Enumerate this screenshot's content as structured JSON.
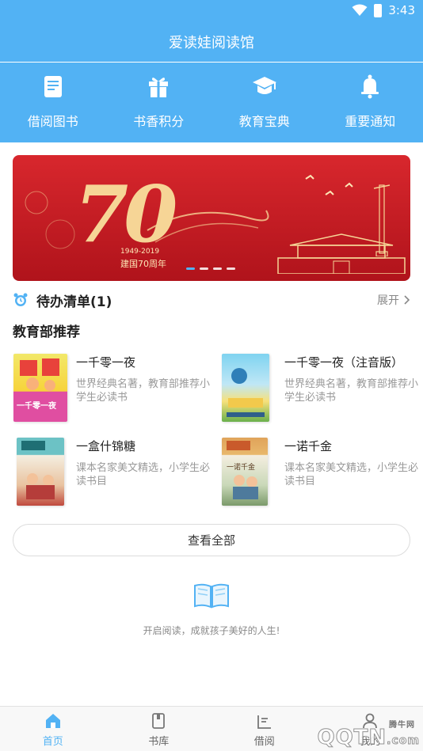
{
  "status_bar": {
    "time": "3:43"
  },
  "header": {
    "title": "爱读娃阅读馆"
  },
  "quick_nav": [
    {
      "label": "借阅图书",
      "icon": "book-icon"
    },
    {
      "label": "书香积分",
      "icon": "gift-icon"
    },
    {
      "label": "教育宝典",
      "icon": "graduation-cap-icon"
    },
    {
      "label": "重要通知",
      "icon": "bell-icon"
    }
  ],
  "banner": {
    "headline": "70",
    "years": "1949-2019",
    "caption": "建国70周年",
    "slide_count": 4,
    "active_slide": 1
  },
  "todo": {
    "title": "待办清单(1)",
    "expand_label": "展开"
  },
  "recommend": {
    "title": "教育部推荐",
    "books": [
      {
        "title": "一千零一夜",
        "desc": "世界经典名著，教育部推荐小学生必读书",
        "cover_text": "一千零一夜"
      },
      {
        "title": "一千零一夜（注音版）",
        "desc": "世界经典名著，教育部推荐小学生必读书",
        "cover_text": ""
      },
      {
        "title": "一盒什锦糖",
        "desc": "课本名家美文精选，小学生必读书目",
        "cover_text": ""
      },
      {
        "title": "一诺千金",
        "desc": "课本名家美文精选，小学生必读书目",
        "cover_text": "一诺千金"
      }
    ],
    "view_all_label": "查看全部"
  },
  "footer": {
    "slogan": "开启阅读，成就孩子美好的人生!"
  },
  "tabs": [
    {
      "label": "首页",
      "icon": "home-icon",
      "active": true
    },
    {
      "label": "书库",
      "icon": "library-icon",
      "active": false
    },
    {
      "label": "借阅",
      "icon": "borrow-icon",
      "active": false
    },
    {
      "label": "我的",
      "icon": "user-icon",
      "active": false
    }
  ],
  "watermark": {
    "text": "QQTN",
    "sub": "腾牛网",
    "domain": ".com"
  },
  "colors": {
    "primary": "#52b2f4",
    "banner_red": "#c41a22",
    "gold": "#f6d596"
  }
}
